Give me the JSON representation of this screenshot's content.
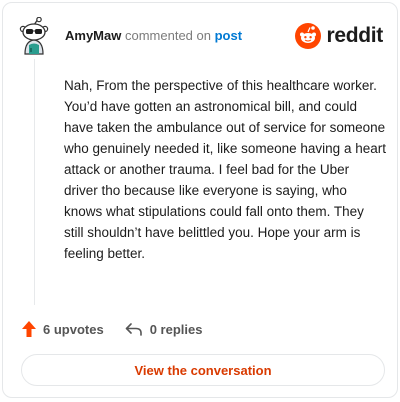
{
  "comment": {
    "username": "AmyMaw",
    "action_text": "commented on",
    "target_link": "post",
    "body": "Nah, From the perspective of this healthcare worker. You’d have gotten an astronomical bill, and could have taken the ambulance out of service for someone who genuinely needed it, like someone having a heart attack or another trauma. I feel bad for the Uber driver tho because like everyone is saying, who knows what stipulations could fall onto them. They still shouldn’t have belittled you. Hope your arm is feeling better."
  },
  "brand": {
    "wordmark": "reddit",
    "color": "#ff4500"
  },
  "actions": {
    "upvotes": "6 upvotes",
    "replies": "0 replies"
  },
  "footer": {
    "cta_label": "View the conversation",
    "cta_color": "#d93a00"
  },
  "icons": [
    "avatar-snoo",
    "reddit-logo-icon",
    "upvote-arrow-icon",
    "reply-arrow-icon"
  ]
}
